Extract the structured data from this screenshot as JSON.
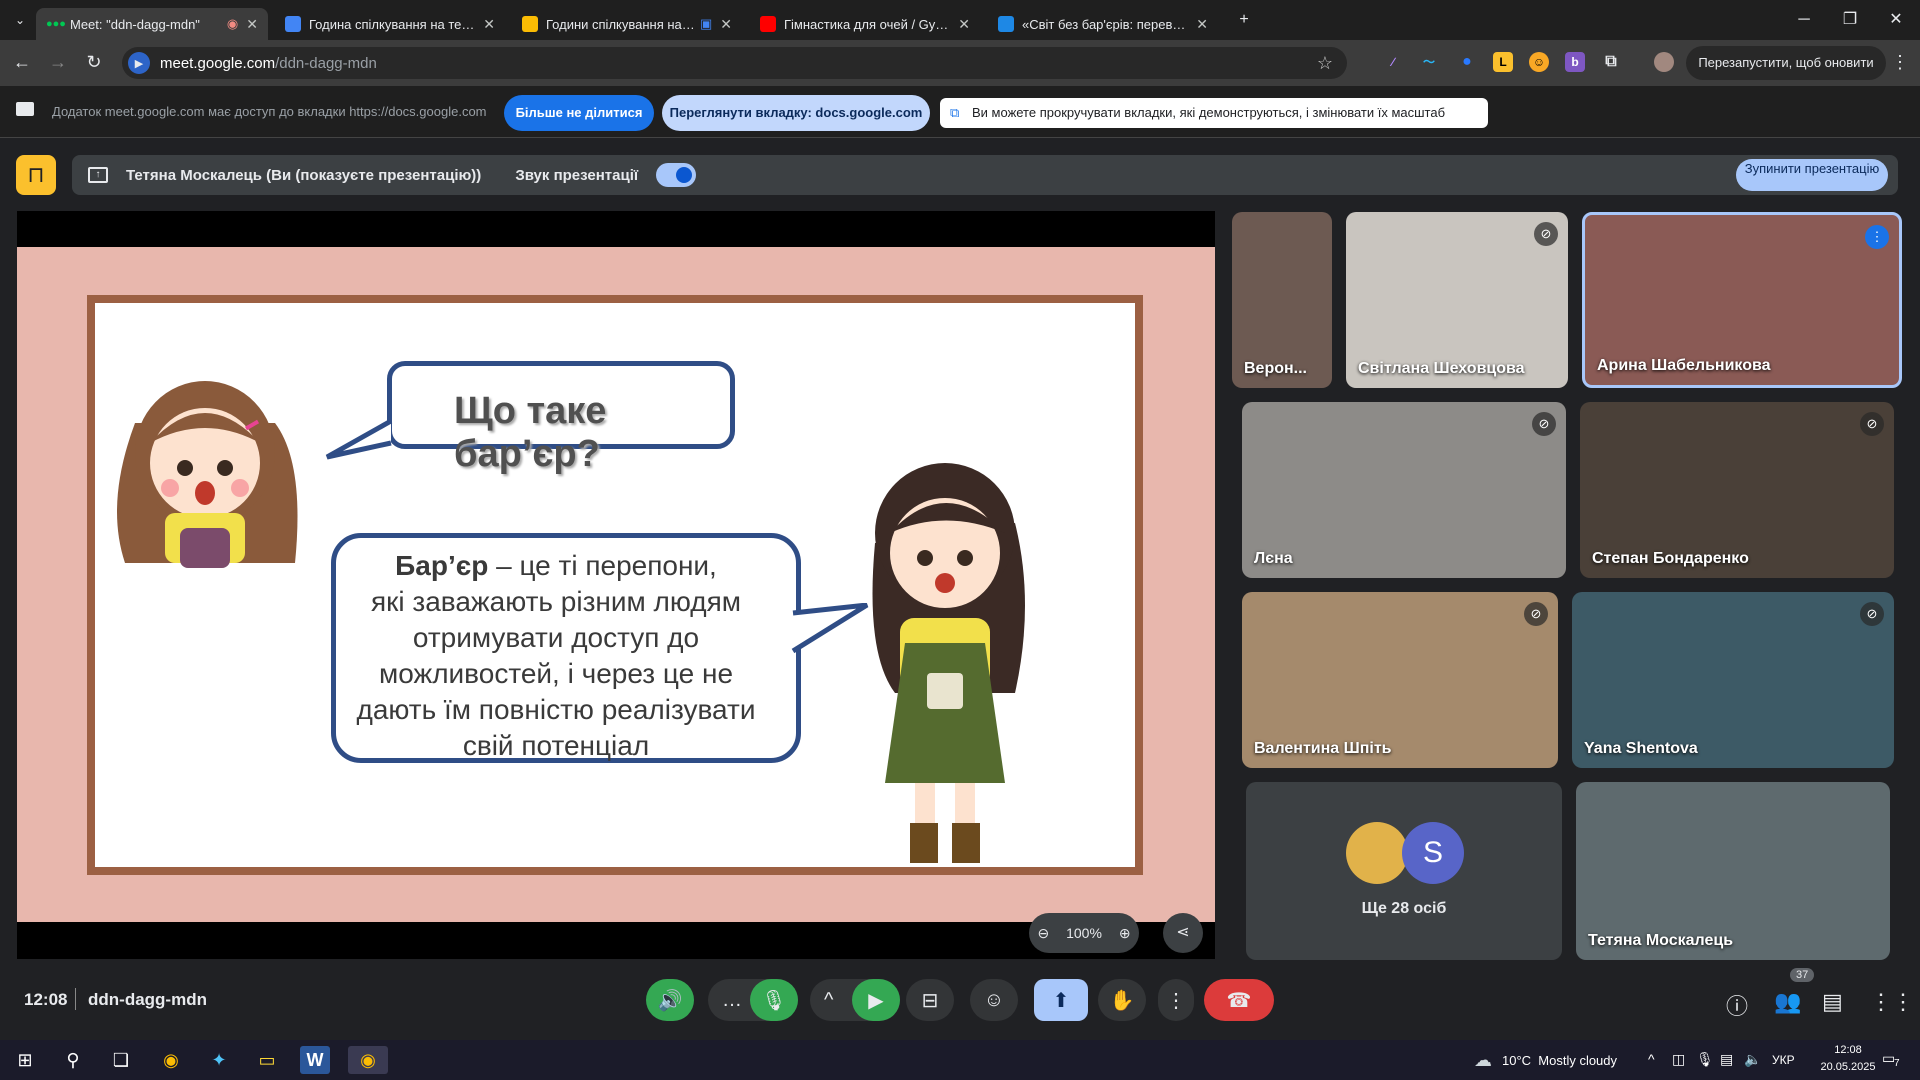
{
  "browser": {
    "tabs": [
      {
        "title": "Meet: \"ddn-dagg-mdn\"",
        "icon": "meet-dots-icon",
        "color": "#00c853"
      },
      {
        "title": "Година спілкування на тему: «",
        "icon": "docs-icon",
        "color": "#4285f4"
      },
      {
        "title": "Години спілкування на тему",
        "icon": "slides-icon",
        "color": "#fbbc04"
      },
      {
        "title": "Гімнастика для очей / Gymnas",
        "icon": "youtube-icon",
        "color": "#ff0000"
      },
      {
        "title": "«Світ без бар'єрів: перевір себе",
        "icon": "wordwall-icon",
        "color": "#1e88e5"
      }
    ],
    "new_tab": "+",
    "url_domain": "meet.google.com",
    "url_path": "/ddn-dagg-mdn",
    "relaunch": "Перезапустити, щоб оновити дані"
  },
  "infobar": {
    "message": "Додаток meet.google.com має доступ до вкладки https://docs.google.com",
    "stop_sharing": "Більше не ділитися",
    "view_tab": "Переглянути вкладку: docs.google.com",
    "hint": "Ви можете прокручувати вкладки, які демонструються, і змінювати їх масштаб"
  },
  "meet": {
    "presenter": "Тетяна Москалець (Ви (показуєте презентацію))",
    "audio_label": "Звук презентації",
    "stop_presenting": "Зупинити презентацію",
    "zoom": "100%",
    "time": "12:08",
    "meeting_code": "ddn-dagg-mdn",
    "participants_count": "37",
    "others": "Ще 28 осіб",
    "others_avatar": "S"
  },
  "slide": {
    "question": "Що таке бар’єр?",
    "term": "Бар’єр",
    "definition_lines": [
      " –  це ті перепони,",
      "які заважають різним людям",
      "отримувати доступ до",
      "можливостей, і через це не",
      "дають їм повністю реалізувати",
      "свій потенціал"
    ]
  },
  "participants": [
    {
      "name": "Верон...",
      "bg": "#6d5a52",
      "muted": false
    },
    {
      "name": "Світлана Шеховцова",
      "bg": "#c9c5bf",
      "muted": true
    },
    {
      "name": "Арина Шабельникова",
      "bg": "#8a5a55",
      "muted": false,
      "speaking": true
    },
    {
      "name": "Лєна",
      "bg": "#8d8b88",
      "muted": true
    },
    {
      "name": "Степан Бондаренко",
      "bg": "#4a4038",
      "muted": true
    },
    {
      "name": "Валентина Шпіть",
      "bg": "#a58a6c",
      "muted": true
    },
    {
      "name": "Yana Shentova",
      "bg": "#3d5a66",
      "muted": true
    },
    {
      "name": "Тетяна Москалець",
      "bg": "#5e6a6e",
      "muted": false
    }
  ],
  "taskbar": {
    "weather": "10°C  Mostly cloudy",
    "lang": "УКР",
    "clock_time": "12:08",
    "clock_date": "20.05.2025",
    "notif": "7"
  }
}
